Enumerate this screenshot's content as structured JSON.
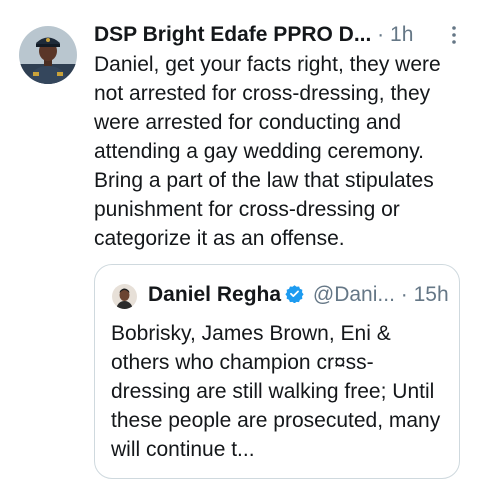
{
  "tweet": {
    "author_name": "DSP Bright Edafe PPRO D...",
    "separator": "·",
    "time": "1h",
    "avatar_icon": "police-officer-avatar",
    "more_icon": "more-vertical-icon",
    "text": "Daniel, get your facts right, they were not arrested for cross-dressing, they were arrested for conducting and attending a gay wedding ceremony. Bring a part of the law that stipulates punishment for cross-dressing or categorize it as an offense."
  },
  "quoted_tweet": {
    "author_name": "Daniel Regha",
    "verified_icon": "verified-badge-icon",
    "handle": "@Dani...",
    "separator": "·",
    "time": "15h",
    "avatar_icon": "user-avatar",
    "text": "Bobrisky, James Brown, Eni & others who champion cr¤ss-dressing are still walking free; Until these people are prosecuted, many will continue t..."
  },
  "colors": {
    "text_primary": "#14171a",
    "text_secondary": "#657786",
    "border": "#cfd9de",
    "verified_blue": "#1d9bf0"
  }
}
